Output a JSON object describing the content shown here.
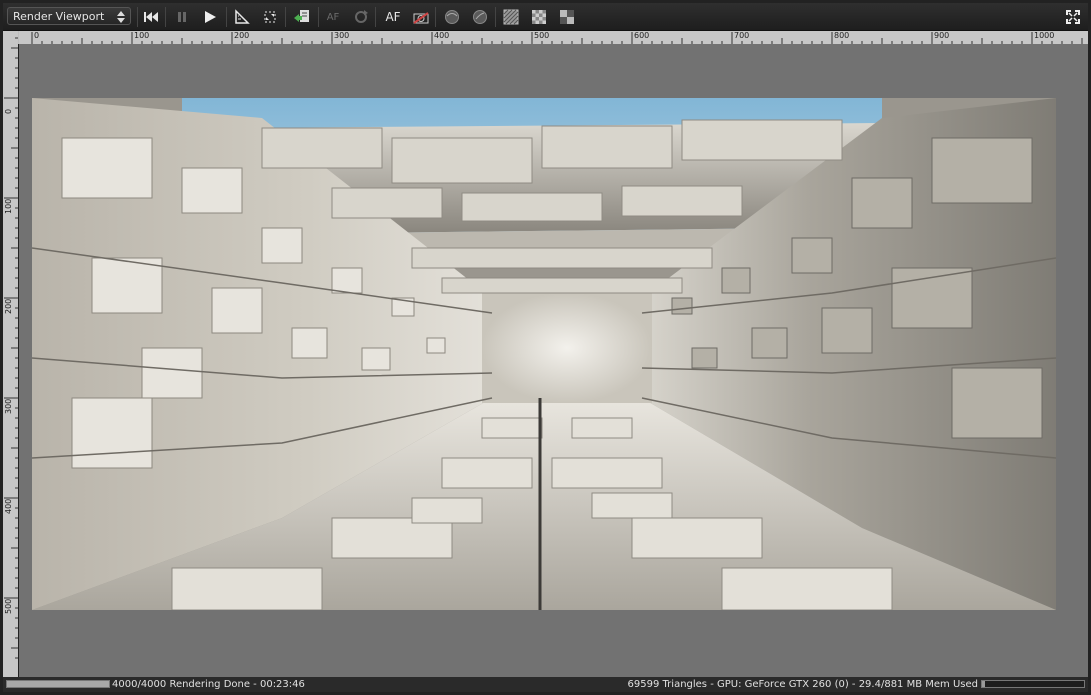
{
  "toolbar": {
    "viewport_select": "Render Viewport",
    "autofocus_label": "AF",
    "autofocus_dim_label": "AF"
  },
  "icons": [
    "rewind-icon",
    "pause-icon",
    "play-icon",
    "ruler-icon",
    "region-icon",
    "import-icon",
    "autofocus-icon",
    "refresh-icon",
    "af-icon",
    "camera-icon",
    "sphere-icon",
    "sphere-alt-icon",
    "checker-icon",
    "checker-alt-icon",
    "checker-dark-icon",
    "fullscreen-icon"
  ],
  "ruler": {
    "h_labels": [
      "0",
      "100",
      "200",
      "300",
      "400",
      "500",
      "600",
      "700",
      "800",
      "900",
      "1000"
    ],
    "v_labels": [
      "0",
      "100",
      "200",
      "300",
      "400",
      "500"
    ]
  },
  "status": {
    "progress": 1.0,
    "progress_text": "4000/4000 Rendering Done - 00:23:46",
    "stats_text": "69599 Triangles - GPU: GeForce GTX 260 (0) - 29.4/881 MB Mem Used",
    "memory_fraction": 0.033
  },
  "colors": {
    "canvas_bg": "#727272",
    "sky": "#8fb9d3",
    "stone": "#cfcbc1"
  }
}
